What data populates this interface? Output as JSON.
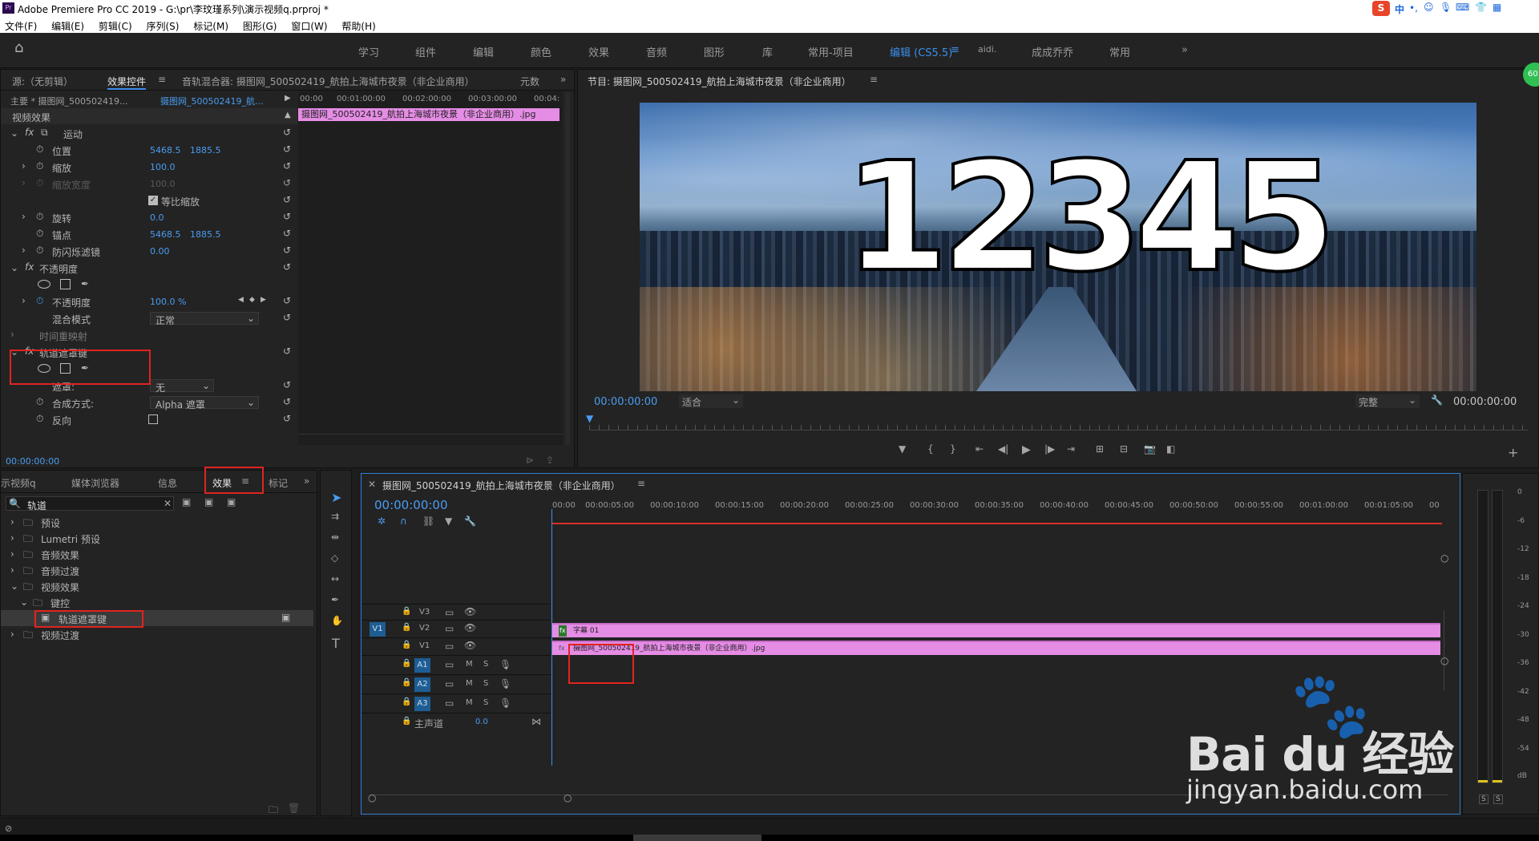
{
  "app": {
    "title": "Adobe Premiere Pro CC 2019 - G:\\pr\\李玟瑾系列\\演示视频q.prproj *",
    "icon_text": "Pr"
  },
  "menu": [
    "文件(F)",
    "编辑(E)",
    "剪辑(C)",
    "序列(S)",
    "标记(M)",
    "图形(G)",
    "窗口(W)",
    "帮助(H)"
  ],
  "tray": {
    "s": "S",
    "lang": "中",
    "dot": "•,"
  },
  "workspaces": [
    "学习",
    "组件",
    "编辑",
    "颜色",
    "效果",
    "音频",
    "图形",
    "库",
    "常用-项目",
    "编辑 (CS5.5)",
    "aidi.",
    "成成乔乔",
    "常用"
  ],
  "workspace_active_index": 9,
  "effect_controls": {
    "tabs": [
      "源:（无剪辑）",
      "效果控件",
      "音轨混合器: 摄图网_500502419_航拍上海城市夜景（非企业商用）",
      "元数"
    ],
    "master": "主要 * 摄图网_500502419...",
    "clip": "摄图网_500502419_航...",
    "ruler": [
      "00:00",
      "00:01:00:00",
      "00:02:00:00",
      "00:03:00:00",
      "00:04:"
    ],
    "clip_bar": "摄图网_500502419_航拍上海城市夜景（非企业商用）.jpg",
    "section": "视频效果",
    "rows": {
      "motion": "运动",
      "position": "位置",
      "pos_x": "5468.5",
      "pos_y": "1885.5",
      "scale": "缩放",
      "scale_val": "100.0",
      "scale_w": "缩放宽度",
      "scale_w_val": "100.0",
      "uniform": "等比缩放",
      "rotation": "旋转",
      "rotation_val": "0.0",
      "anchor": "锚点",
      "anc_x": "5468.5",
      "anc_y": "1885.5",
      "flicker": "防闪烁滤镜",
      "flicker_val": "0.00",
      "opacity": "不透明度",
      "opacity_label": "不透明度",
      "opacity_val": "100.0 %",
      "blend": "混合模式",
      "blend_val": "正常",
      "timeremap": "时间重映射",
      "trackmatte": "轨道遮罩键",
      "mask": "遮罩:",
      "mask_val": "无",
      "composite": "合成方式:",
      "composite_val": "Alpha 遮罩",
      "reverse": "反向"
    },
    "timecode": "00:00:00:00"
  },
  "program": {
    "title": "节目: 摄图网_500502419_航拍上海城市夜景（非企业商用）",
    "overlay": "12345",
    "timecode": "00:00:00:00",
    "fit": "适合",
    "quality": "完整",
    "duration": "00:00:00:00"
  },
  "effects_panel": {
    "tabs": [
      "示视频q",
      "媒体浏览器",
      "信息",
      "效果",
      "标记"
    ],
    "search": "轨道",
    "tree": [
      "预设",
      "Lumetri 预设",
      "音频效果",
      "音频过渡",
      "视频效果",
      "键控",
      "轨道遮罩键",
      "视频过渡"
    ]
  },
  "timeline": {
    "title": "摄图网_500502419_航拍上海城市夜景（非企业商用）",
    "timecode": "00:00:00:00",
    "ticks": [
      "00:00",
      "00:00:05:00",
      "00:00:10:00",
      "00:00:15:00",
      "00:00:20:00",
      "00:00:25:00",
      "00:00:30:00",
      "00:00:35:00",
      "00:00:40:00",
      "00:00:45:00",
      "00:00:50:00",
      "00:00:55:00",
      "00:01:00:00",
      "00:01:05:00",
      "00"
    ],
    "tracks": {
      "v3": "V3",
      "v2": "V2",
      "v1": "V1",
      "src_v1": "V1",
      "a1": "A1",
      "a2": "A2",
      "a3": "A3",
      "m": "M",
      "s": "S",
      "master": "主声道",
      "master_val": "0.0"
    },
    "clip_v2": "字幕 01",
    "clip_v1": "摄图网_500502419_航拍上海城市夜景（非企业商用）.jpg"
  },
  "meter": {
    "labels": [
      "0",
      "-6",
      "-12",
      "-18",
      "-24",
      "-30",
      "-36",
      "-42",
      "-48",
      "-54",
      "dB"
    ],
    "s1": "S",
    "s2": "S"
  },
  "watermark": {
    "brand": "Bai du 经验",
    "url": "jingyan.baidu.com"
  },
  "badge": "60"
}
